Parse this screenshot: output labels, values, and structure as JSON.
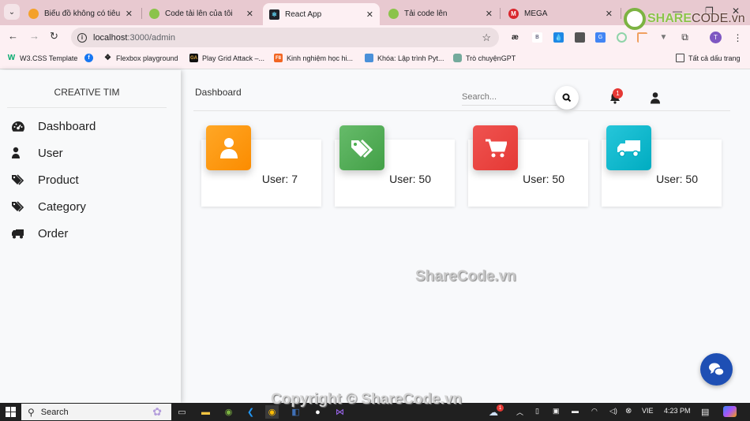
{
  "browser": {
    "tabs": [
      {
        "title": "Biểu đồ không có tiêu đề",
        "favicon_color": "#f4a12a",
        "active": false
      },
      {
        "title": "Code tải lên của tôi",
        "favicon_color": "#8bc34a",
        "active": false
      },
      {
        "title": "React App",
        "favicon_color": "#20232a",
        "active": true
      },
      {
        "title": "Tải code lên",
        "favicon_color": "#8bc34a",
        "active": false
      },
      {
        "title": "MEGA",
        "favicon_color": "#d9272e",
        "active": false
      }
    ],
    "url_host": "localhost",
    "url_path": ":3000/admin",
    "bookmarks": [
      {
        "label": "W3.CSS Template",
        "color": "#04aa6d"
      },
      {
        "label": "",
        "color": "#1877f2"
      },
      {
        "label": "Flexbox playground",
        "color": "#ffffff"
      },
      {
        "label": "Play Grid Attack –...",
        "color": "#111111"
      },
      {
        "label": "Kinh nghiệm học hi...",
        "color": "#f26522"
      },
      {
        "label": "Khóa: Lập trình Pyt...",
        "color": "#4a90d9"
      },
      {
        "label": "Trò chuyệnGPT",
        "color": "#74aa9c"
      }
    ],
    "all_bookmarks": "Tất cả dấu trang",
    "profile_initial": "T"
  },
  "sidebar": {
    "brand": "CREATIVE TIM",
    "items": [
      {
        "label": "Dashboard",
        "icon": "gauge-icon"
      },
      {
        "label": "User",
        "icon": "user-icon"
      },
      {
        "label": "Product",
        "icon": "tags-icon"
      },
      {
        "label": "Category",
        "icon": "tags-icon"
      },
      {
        "label": "Order",
        "icon": "truck-icon"
      }
    ]
  },
  "header": {
    "breadcrumb": "Dashboard",
    "search_placeholder": "Search...",
    "notification_count": "1"
  },
  "cards": [
    {
      "value": "User: 7",
      "icon": "user-icon",
      "color": "#ff9800"
    },
    {
      "value": "User: 50",
      "icon": "tags-icon",
      "color": "#4caf50"
    },
    {
      "value": "User: 50",
      "icon": "cart-icon",
      "color": "#e53935"
    },
    {
      "value": "User: 50",
      "icon": "truck-icon",
      "color": "#00acc1"
    }
  ],
  "watermarks": {
    "center": "ShareCode.vn",
    "bottom": "Copyright © ShareCode.vn",
    "logo_a": "SHARE",
    "logo_b": "CODE.vn"
  },
  "taskbar": {
    "search": "Search",
    "weather_badge": "1",
    "language": "VIE",
    "time": "4:23 PM"
  }
}
